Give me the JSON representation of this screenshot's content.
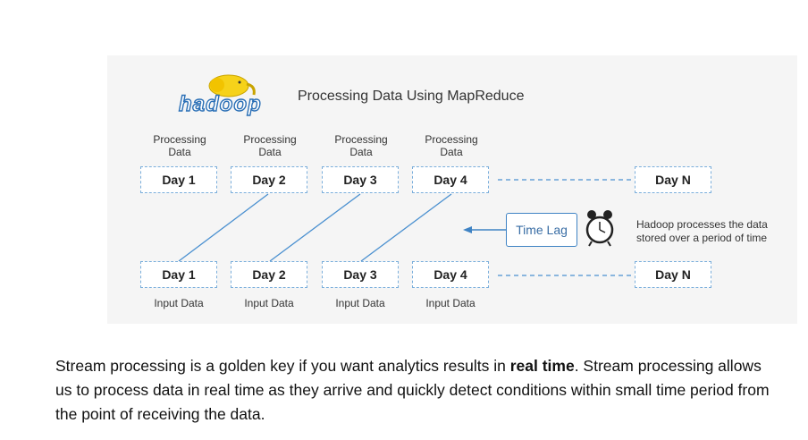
{
  "logo": {
    "text": "hadoop",
    "icon": "elephant-logo"
  },
  "title": "Processing Data Using MapReduce",
  "processing_labels": [
    "Processing\nData",
    "Processing\nData",
    "Processing\nData",
    "Processing\nData"
  ],
  "top_row": [
    "Day 1",
    "Day 2",
    "Day 3",
    "Day 4",
    "Day N"
  ],
  "bottom_row": [
    "Day 1",
    "Day 2",
    "Day 3",
    "Day 4",
    "Day N"
  ],
  "input_labels": [
    "Input Data",
    "Input Data",
    "Input Data",
    "Input Data"
  ],
  "time_lag": "Time Lag",
  "note": "Hadoop processes the data\nstored over a period of time",
  "paragraph": {
    "before": "Stream processing is a golden key if you want analytics results in ",
    "bold": "real time",
    "after": ". Stream processing allows us to process data in real time as they arrive and quickly detect conditions within small time period from the point of receiving the data."
  },
  "colors": {
    "box_border": "#7aaedb",
    "line": "#4a90d0",
    "logo_yellow": "#f6d21a",
    "logo_blue": "#2a6fb6"
  }
}
